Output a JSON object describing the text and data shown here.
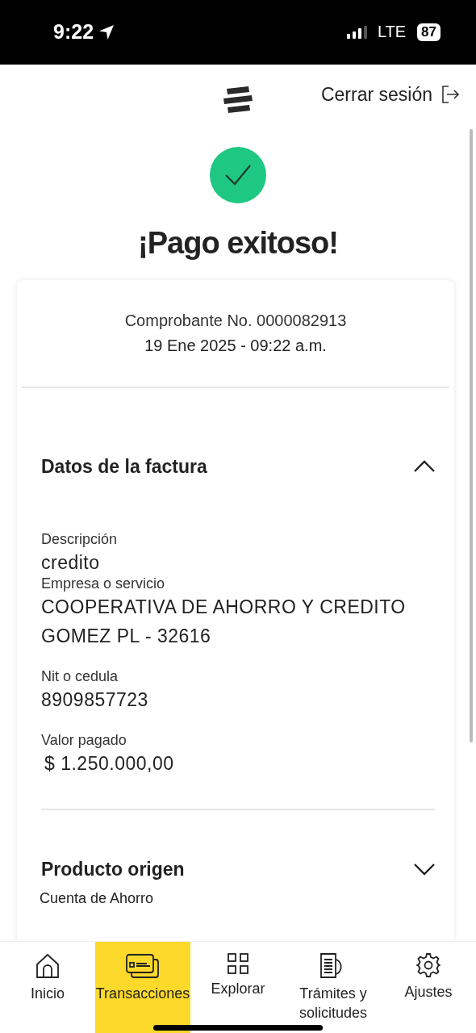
{
  "status_bar": {
    "time": "9:22",
    "network": "LTE",
    "battery": "87"
  },
  "header": {
    "logout": "Cerrar sesión"
  },
  "title": "¡Pago exitoso!",
  "receipt": {
    "number": "Comprobante No. 0000082913",
    "date": "19 Ene 2025 - 09:22 a.m."
  },
  "sections": [
    {
      "title": "Datos de la factura",
      "expanded": true,
      "fields": [
        {
          "label": "Descripción",
          "value": "credito"
        },
        {
          "label": "Empresa o servicio",
          "value": "COOPERATIVA DE AHORRO Y CREDITO GOMEZ PL - 32616"
        },
        {
          "label": "Nit o cedula",
          "value": "8909857723"
        },
        {
          "label": "Valor pagado",
          "value": "$ 1.250.000,00"
        }
      ]
    },
    {
      "title": "Producto origen",
      "expanded": false,
      "summary": "Cuenta de Ahorro"
    }
  ],
  "nav": [
    {
      "label": "Inicio",
      "selected": false
    },
    {
      "label": "Transacciones",
      "selected": true
    },
    {
      "label": "Explorar",
      "selected": false
    },
    {
      "label": "Trámites y solicitudes",
      "selected": false
    },
    {
      "label": "Ajustes",
      "selected": false
    }
  ]
}
